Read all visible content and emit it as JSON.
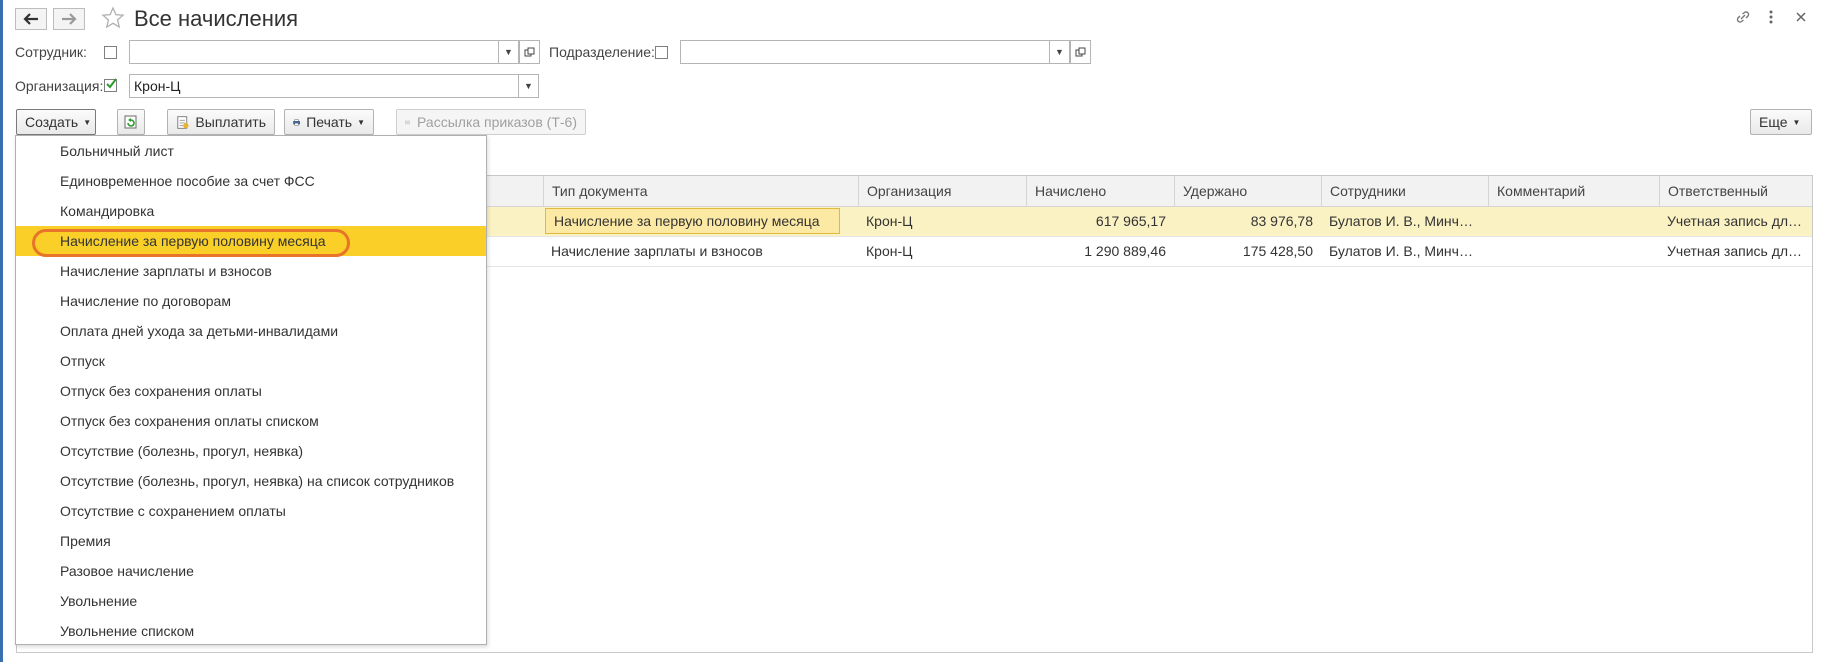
{
  "title": "Все начисления",
  "filters": {
    "employee_label": "Сотрудник:",
    "employee_value": "",
    "department_label": "Подразделение:",
    "department_value": "",
    "organization_label": "Организация:",
    "organization_value": "Крон-Ц",
    "organization_checked": true
  },
  "toolbar": {
    "create": "Создать",
    "pay": "Выплатить",
    "print": "Печать",
    "mailing": "Рассылка приказов (Т-6)",
    "more": "Еще"
  },
  "table": {
    "headers": [
      "Тип документа",
      "Организация",
      "Начислено",
      "Удержано",
      "Сотрудники",
      "Комментарий",
      "Ответственный"
    ],
    "rows": [
      {
        "type": "Начисление за первую половину месяца",
        "org": "Крон-Ц",
        "accrued": "617 965,17",
        "withheld": "83 976,78",
        "employees": "Булатов И. В., Минчев...",
        "comment": "",
        "responsible": "Учетная запись для ус..."
      },
      {
        "type": "Начисление зарплаты и взносов",
        "org": "Крон-Ц",
        "accrued": "1 290 889,46",
        "withheld": "175 428,50",
        "employees": "Булатов И. В., Минчев...",
        "comment": "",
        "responsible": "Учетная запись для ус..."
      }
    ]
  },
  "create_menu": {
    "items": [
      "Больничный лист",
      "Единовременное пособие за счет ФСС",
      "Командировка",
      "Начисление за первую половину месяца",
      "Начисление зарплаты и взносов",
      "Начисление по договорам",
      "Оплата дней ухода за детьми-инвалидами",
      "Отпуск",
      "Отпуск без сохранения оплаты",
      "Отпуск без сохранения оплаты списком",
      "Отсутствие (болезнь, прогул, неявка)",
      "Отсутствие (болезнь, прогул, неявка) на список сотрудников",
      "Отсутствие с сохранением оплаты",
      "Премия",
      "Разовое начисление",
      "Увольнение",
      "Увольнение списком"
    ],
    "highlighted_index": 3
  },
  "colors": {
    "highlight": "#f9cf28",
    "selected_row": "#fbf2c4",
    "annotation_ring": "#e8742a",
    "check_green": "#2e9b2e"
  },
  "icons": [
    "arrow-left-icon",
    "arrow-right-icon",
    "star-icon",
    "link-icon",
    "more-vertical-icon",
    "close-icon",
    "open-form-icon",
    "refresh-icon",
    "pay-icon",
    "printer-icon",
    "envelope-icon"
  ]
}
